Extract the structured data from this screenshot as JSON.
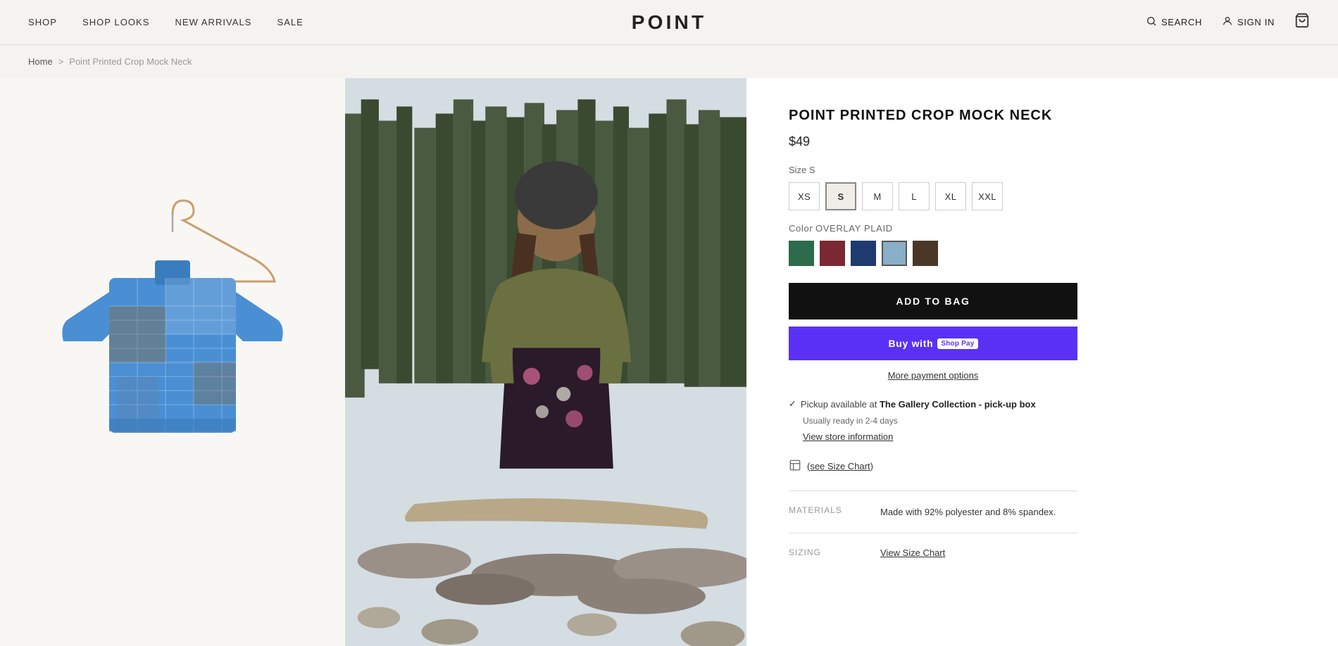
{
  "nav": {
    "shop": "SHOP",
    "shop_looks": "SHOP LOOKS",
    "new_arrivals": "NEW ARRIVALS",
    "sale": "SALE",
    "logo": "POINT",
    "search": "SEARCH",
    "sign_in": "SIGN IN"
  },
  "breadcrumb": {
    "home": "Home",
    "separator": ">",
    "current": "Point Printed Crop Mock Neck"
  },
  "product": {
    "title": "POINT PRINTED CROP MOCK NECK",
    "price": "$49",
    "size_label": "Size",
    "selected_size": "S",
    "sizes": [
      "XS",
      "S",
      "M",
      "L",
      "XL",
      "XXL"
    ],
    "color_label": "Color",
    "selected_color": "OVERLAY PLAID",
    "colors": [
      {
        "name": "forest-green",
        "hex": "#2d6b4a"
      },
      {
        "name": "burgundy",
        "hex": "#7a2832"
      },
      {
        "name": "navy",
        "hex": "#1e3a6e"
      },
      {
        "name": "light-blue",
        "hex": "#89aec8"
      },
      {
        "name": "dark-brown",
        "hex": "#4a3728"
      }
    ],
    "add_to_bag": "ADD TO BAG",
    "buy_with": "Buy with",
    "shop_pay": "Shop Pay",
    "more_payment": "More payment options",
    "pickup_check": "✓",
    "pickup_text": "Pickup available at",
    "pickup_location": "The Gallery Collection - pick-up box",
    "pickup_ready": "Usually ready in 2-4 days",
    "view_store": "View store information",
    "size_chart": "(see Size Chart)",
    "materials_key": "MATERIALS",
    "materials_val": "Made with 92% polyester and 8% spandex.",
    "sizing_key": "SIZING",
    "sizing_val": "View Size Chart"
  }
}
